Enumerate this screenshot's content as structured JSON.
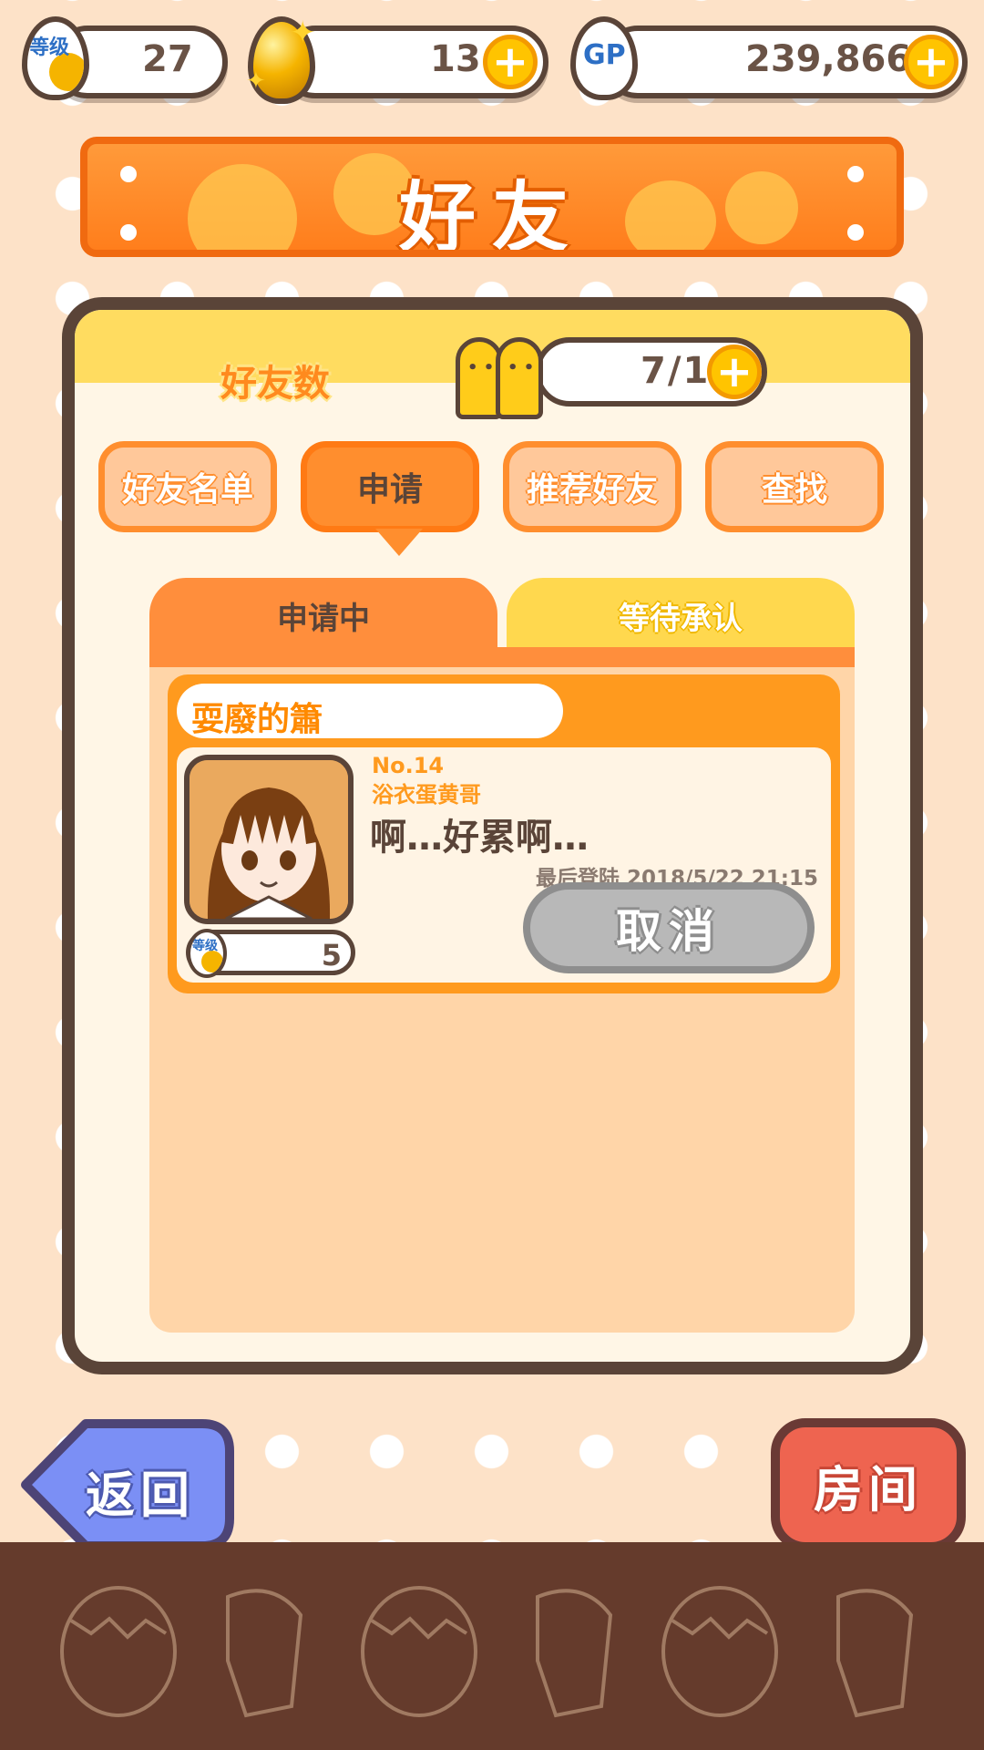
{
  "status_bar": {
    "level_badge": "等级",
    "level_value": "27",
    "eggs_value": "13",
    "gp_badge": "GP",
    "gp_value": "239,866",
    "plus_symbol": "+"
  },
  "banner": {
    "title": "好友"
  },
  "panel": {
    "friends_count_label": "好友数",
    "friends_count_value": "7/10",
    "tabs": [
      {
        "label": "好友名单",
        "active": false
      },
      {
        "label": "申请",
        "active": true
      },
      {
        "label": "推荐好友",
        "active": false
      },
      {
        "label": "查找",
        "active": false
      }
    ],
    "subtabs": [
      {
        "label": "申请中",
        "active": true
      },
      {
        "label": "等待承认",
        "active": false
      }
    ],
    "requests": [
      {
        "name": "耍廢的簫",
        "number": "No.14",
        "character": "浴衣蛋黄哥",
        "message": "啊…好累啊…",
        "last_login": "最后登陆 2018/5/22 21:15",
        "level_badge": "等级",
        "level": "5",
        "cancel_label": "取消"
      }
    ]
  },
  "navigation": {
    "back_label": "返回",
    "room_label": "房间"
  },
  "colors": {
    "orange": "#ff8e2e",
    "brown": "#5a4438",
    "yellow": "#ffd84e",
    "back_blue": "#7b8ff5",
    "room_red": "#ee6450",
    "footer": "#653b2c"
  }
}
